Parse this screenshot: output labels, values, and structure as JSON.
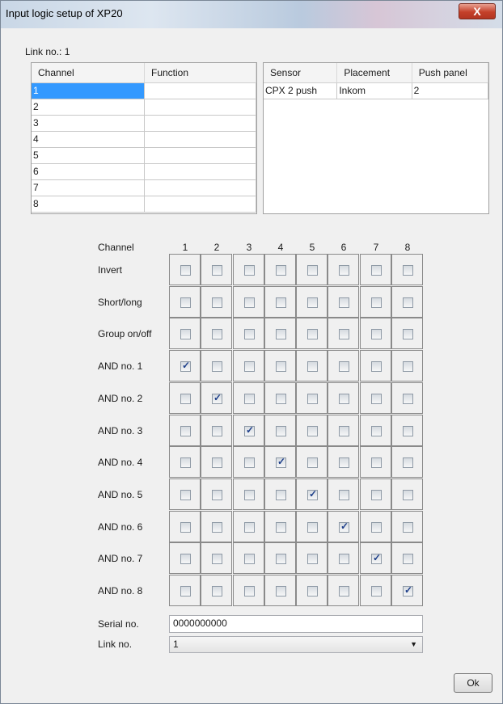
{
  "window": {
    "title": "Input logic setup of XP20",
    "close": "X"
  },
  "link_label": "Link no.: 1",
  "left_table": {
    "headers": [
      "Channel",
      "Function"
    ],
    "rows": [
      [
        "1",
        ""
      ],
      [
        "2",
        ""
      ],
      [
        "3",
        ""
      ],
      [
        "4",
        ""
      ],
      [
        "5",
        ""
      ],
      [
        "6",
        ""
      ],
      [
        "7",
        ""
      ],
      [
        "8",
        ""
      ]
    ],
    "selected_row": 0
  },
  "right_table": {
    "headers": [
      "Sensor",
      "Placement",
      "Push panel"
    ],
    "rows": [
      [
        "CPX 2 push",
        "Inkom",
        "2"
      ]
    ]
  },
  "matrix": {
    "channel_label": "Channel",
    "columns": [
      "1",
      "2",
      "3",
      "4",
      "5",
      "6",
      "7",
      "8"
    ],
    "rows": [
      {
        "label": "Invert",
        "checked": []
      },
      {
        "label": "Short/long",
        "checked": []
      },
      {
        "label": "Group on/off",
        "checked": []
      },
      {
        "label": "AND no. 1",
        "checked": [
          1
        ]
      },
      {
        "label": "AND no. 2",
        "checked": [
          2
        ]
      },
      {
        "label": "AND no. 3",
        "checked": [
          3
        ]
      },
      {
        "label": "AND no. 4",
        "checked": [
          4
        ]
      },
      {
        "label": "AND no. 5",
        "checked": [
          5
        ]
      },
      {
        "label": "AND no. 6",
        "checked": [
          6
        ]
      },
      {
        "label": "AND no. 7",
        "checked": [
          7
        ]
      },
      {
        "label": "AND no. 8",
        "checked": [
          8
        ]
      }
    ]
  },
  "serial": {
    "label": "Serial no.",
    "value": "0000000000"
  },
  "link": {
    "label": "Link no.",
    "value": "1"
  },
  "ok_label": "Ok"
}
